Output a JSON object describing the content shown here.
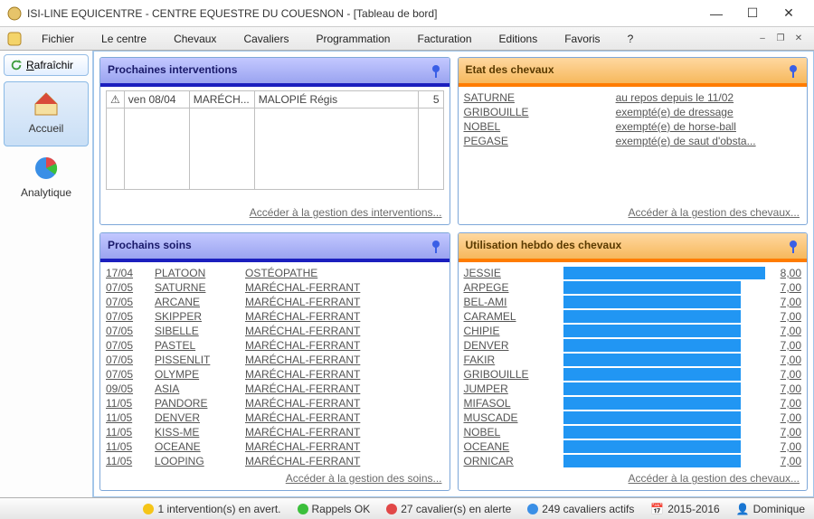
{
  "window": {
    "title": "ISI-LINE EQUICENTRE - CENTRE EQUESTRE DU COUESNON - [Tableau de bord]"
  },
  "menu": [
    "Fichier",
    "Le centre",
    "Chevaux",
    "Cavaliers",
    "Programmation",
    "Facturation",
    "Editions",
    "Favoris",
    "?"
  ],
  "sidebar": {
    "refresh": "Rafraîchir",
    "items": [
      {
        "label": "Accueil"
      },
      {
        "label": "Analytique"
      }
    ]
  },
  "panels": {
    "interventions": {
      "title": "Prochaines interventions",
      "footer": "Accéder à la gestion des interventions...",
      "rows": [
        {
          "date": "ven 08/04",
          "type": "MARÉCH...",
          "name": "MALOPIÉ Régis",
          "count": "5"
        }
      ]
    },
    "etat": {
      "title": "Etat des chevaux",
      "footer": "Accéder à la gestion des chevaux...",
      "rows": [
        {
          "name": "SATURNE",
          "status": "au repos depuis le 11/02"
        },
        {
          "name": "GRIBOUILLE",
          "status": "exempté(e) de dressage"
        },
        {
          "name": "NOBEL",
          "status": "exempté(e) de horse-ball"
        },
        {
          "name": "PEGASE",
          "status": "exempté(e) de saut d'obsta..."
        }
      ]
    },
    "soins": {
      "title": "Prochains soins",
      "footer": "Accéder à la gestion des soins...",
      "rows": [
        {
          "date": "17/04",
          "name": "PLATOON",
          "type": "OSTÉOPATHE"
        },
        {
          "date": "07/05",
          "name": "SATURNE",
          "type": "MARÉCHAL-FERRANT"
        },
        {
          "date": "07/05",
          "name": "ARCANE",
          "type": "MARÉCHAL-FERRANT"
        },
        {
          "date": "07/05",
          "name": "SKIPPER",
          "type": "MARÉCHAL-FERRANT"
        },
        {
          "date": "07/05",
          "name": "SIBELLE",
          "type": "MARÉCHAL-FERRANT"
        },
        {
          "date": "07/05",
          "name": "PASTEL",
          "type": "MARÉCHAL-FERRANT"
        },
        {
          "date": "07/05",
          "name": "PISSENLIT",
          "type": "MARÉCHAL-FERRANT"
        },
        {
          "date": "07/05",
          "name": "OLYMPE",
          "type": "MARÉCHAL-FERRANT"
        },
        {
          "date": "09/05",
          "name": "ASIA",
          "type": "MARÉCHAL-FERRANT"
        },
        {
          "date": "11/05",
          "name": "PANDORE",
          "type": "MARÉCHAL-FERRANT"
        },
        {
          "date": "11/05",
          "name": "DENVER",
          "type": "MARÉCHAL-FERRANT"
        },
        {
          "date": "11/05",
          "name": "KISS-ME",
          "type": "MARÉCHAL-FERRANT"
        },
        {
          "date": "11/05",
          "name": "OCEANE",
          "type": "MARÉCHAL-FERRANT"
        },
        {
          "date": "11/05",
          "name": "LOOPING",
          "type": "MARÉCHAL-FERRANT"
        }
      ]
    },
    "usage": {
      "title": "Utilisation hebdo des chevaux",
      "footer": "Accéder à la gestion des chevaux...",
      "max": 8,
      "rows": [
        {
          "name": "JESSIE",
          "value": "8,00",
          "n": 8
        },
        {
          "name": "ARPEGE",
          "value": "7,00",
          "n": 7
        },
        {
          "name": "BEL-AMI",
          "value": "7,00",
          "n": 7
        },
        {
          "name": "CARAMEL",
          "value": "7,00",
          "n": 7
        },
        {
          "name": "CHIPIE",
          "value": "7,00",
          "n": 7
        },
        {
          "name": "DENVER",
          "value": "7,00",
          "n": 7
        },
        {
          "name": "FAKIR",
          "value": "7,00",
          "n": 7
        },
        {
          "name": "GRIBOUILLE",
          "value": "7,00",
          "n": 7
        },
        {
          "name": "JUMPER",
          "value": "7,00",
          "n": 7
        },
        {
          "name": "MIFASOL",
          "value": "7,00",
          "n": 7
        },
        {
          "name": "MUSCADE",
          "value": "7,00",
          "n": 7
        },
        {
          "name": "NOBEL",
          "value": "7,00",
          "n": 7
        },
        {
          "name": "OCEANE",
          "value": "7,00",
          "n": 7
        },
        {
          "name": "ORNICAR",
          "value": "7,00",
          "n": 7
        }
      ]
    }
  },
  "status": {
    "warn": "1 intervention(s) en avert.",
    "ok": "Rappels OK",
    "alert": "27 cavalier(s) en alerte",
    "actifs": "249 cavaliers actifs",
    "period": "2015-2016",
    "user": "Dominique"
  }
}
